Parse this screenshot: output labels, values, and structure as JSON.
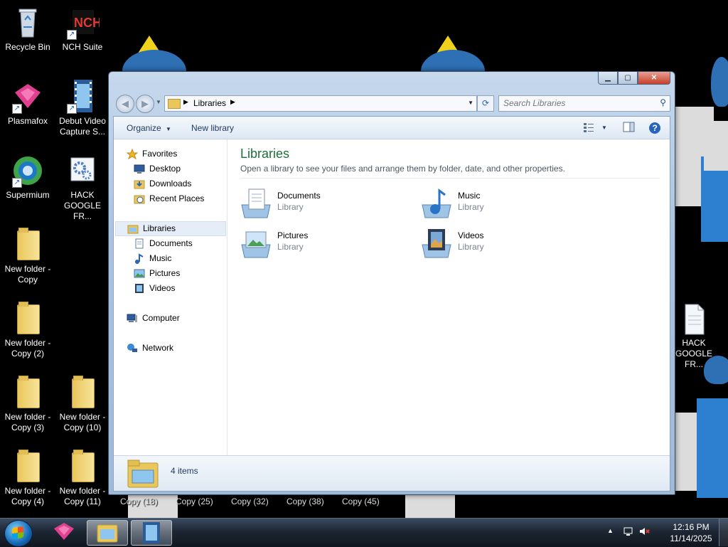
{
  "desktop": {
    "icons": [
      {
        "label": "Recycle Bin",
        "icon": "recycle-bin-icon"
      },
      {
        "label": "NCH Suite",
        "icon": "nch-suite-icon"
      },
      {
        "label": "Plasmafox",
        "icon": "plasmafox-icon"
      },
      {
        "label": "Debut Video Capture S...",
        "icon": "debut-video-icon"
      },
      {
        "label": "Supermium",
        "icon": "supermium-icon"
      },
      {
        "label": "HACK GOOGLE FR...",
        "icon": "settings-gears-icon"
      },
      {
        "label": "New folder - Copy",
        "icon": "folder-icon"
      },
      {
        "label": "New folder - Copy (2)",
        "icon": "folder-icon"
      },
      {
        "label": "New folder - Copy (3)",
        "icon": "folder-icon"
      },
      {
        "label": "New folder - Copy (10)",
        "icon": "folder-icon"
      },
      {
        "label": "New folder - Copy (4)",
        "icon": "folder-icon"
      },
      {
        "label": "New folder - Copy (11)",
        "icon": "folder-icon"
      },
      {
        "label": "HACK GOOGLE FR...",
        "icon": "text-file-icon"
      }
    ],
    "partial_labels": [
      "Copy (18)",
      "Copy (25)",
      "Copy (32)",
      "Copy (38)",
      "Copy (45)"
    ]
  },
  "window": {
    "address": {
      "crumb": "Libraries"
    },
    "search_placeholder": "Search Libraries",
    "toolbar": {
      "organize": "Organize",
      "new_library": "New library"
    },
    "nav": {
      "favorites": "Favorites",
      "favorite_items": [
        "Desktop",
        "Downloads",
        "Recent Places"
      ],
      "libraries": "Libraries",
      "library_items": [
        "Documents",
        "Music",
        "Pictures",
        "Videos"
      ],
      "computer": "Computer",
      "network": "Network"
    },
    "content": {
      "title": "Libraries",
      "subtitle": "Open a library to see your files and arrange them by folder, date, and other properties.",
      "libraries": [
        {
          "name": "Documents",
          "type": "Library",
          "icon": "documents-library-icon"
        },
        {
          "name": "Music",
          "type": "Library",
          "icon": "music-library-icon"
        },
        {
          "name": "Pictures",
          "type": "Library",
          "icon": "pictures-library-icon"
        },
        {
          "name": "Videos",
          "type": "Library",
          "icon": "videos-library-icon"
        }
      ]
    },
    "details": {
      "count": "4 items"
    }
  },
  "taskbar": {
    "time": "12:16 PM",
    "date": "11/14/2025",
    "pinned": [
      "plasmafox-icon",
      "libraries-folder-icon",
      "debut-video-icon"
    ]
  },
  "colors": {
    "content_title": "#1e6e3a",
    "selection": "#e5eef8"
  }
}
